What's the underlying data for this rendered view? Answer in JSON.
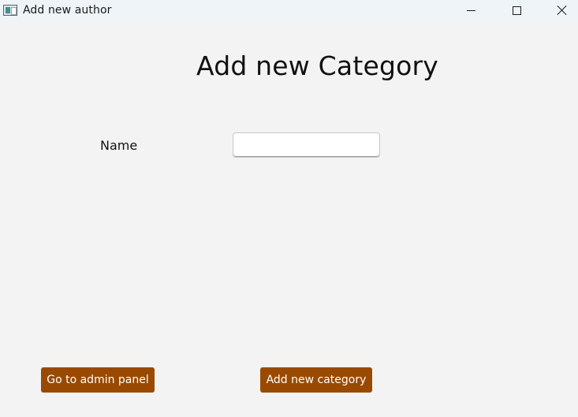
{
  "window": {
    "title": "Add new author",
    "icon": "app-window-icon",
    "controls": {
      "minimize_icon": "minimize-icon",
      "maximize_icon": "maximize-icon",
      "close_icon": "close-icon"
    }
  },
  "form": {
    "heading": "Add new Category",
    "name_label": "Name",
    "name_value": "",
    "name_placeholder": ""
  },
  "actions": {
    "admin_panel_label": "Go to admin panel",
    "add_category_label": "Add new category"
  },
  "colors": {
    "accent": "#9a4a00",
    "background": "#f3f3f3",
    "titlebar": "#eff4f9"
  }
}
